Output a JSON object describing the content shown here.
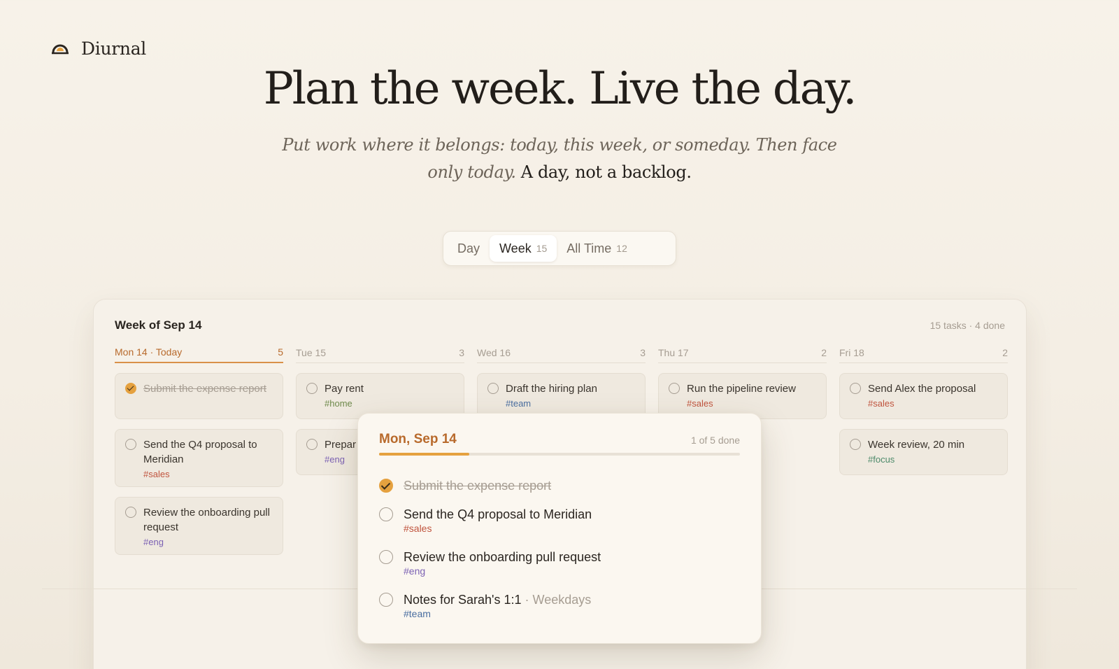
{
  "brand": {
    "name": "Diurnal"
  },
  "hero": {
    "title": "Plan the week. Live the day.",
    "subtitle_italic": "Put work where it belongs: today, this week, or someday. Then face only today.",
    "subtitle_plain": "A day, not a backlog."
  },
  "view_switcher": {
    "items": [
      {
        "label": "Day",
        "count": ""
      },
      {
        "label": "Week",
        "count": "15"
      },
      {
        "label": "All Time",
        "count": "12"
      }
    ],
    "selected": "Week"
  },
  "board": {
    "title": "Week of Sep 14",
    "stats": "15 tasks · 4 done",
    "columns": [
      {
        "label": "Mon 14 · Today",
        "count": "5",
        "tasks": [
          {
            "text": "Submit the expense report",
            "tag": "",
            "done": true
          },
          {
            "text": "Send the Q4 proposal to Meridian",
            "tag": "#sales",
            "done": false
          },
          {
            "text": "Review the onboarding pull request",
            "tag": "#eng",
            "done": false
          }
        ]
      },
      {
        "label": "Tue 15",
        "count": "3",
        "tasks": [
          {
            "text": "Pay rent",
            "tag": "#home",
            "done": false
          },
          {
            "text": "Prepar",
            "tag": "#eng",
            "done": false
          }
        ]
      },
      {
        "label": "Wed 16",
        "count": "3",
        "tasks": [
          {
            "text": "Draft the hiring plan",
            "tag": "#team",
            "done": false
          }
        ]
      },
      {
        "label": "Thu 17",
        "count": "2",
        "tasks": [
          {
            "text": "Run the pipeline review",
            "tag": "#sales",
            "done": false
          }
        ]
      },
      {
        "label": "Fri 18",
        "count": "2",
        "tasks": [
          {
            "text": "Send Alex the proposal",
            "tag": "#sales",
            "done": false
          },
          {
            "text": "Week review, 20 min",
            "tag": "#focus",
            "done": false
          }
        ]
      }
    ]
  },
  "day_popup": {
    "title": "Mon, Sep 14",
    "stat": "1 of 5 done",
    "progress": 0.25,
    "tasks": [
      {
        "text": "Submit the expense report",
        "tag": "",
        "repeat": "",
        "done": true
      },
      {
        "text": "Send the Q4 proposal to Meridian",
        "tag": "#sales",
        "repeat": "",
        "done": false
      },
      {
        "text": "Review the onboarding pull request",
        "tag": "#eng",
        "repeat": "",
        "done": false
      },
      {
        "text": "Notes for Sarah's 1:1",
        "tag": "#team",
        "repeat": "· Weekdays",
        "done": false
      }
    ]
  },
  "colors": {
    "accent": "#e5a13f",
    "today_text": "#b86a2c",
    "tag_sales": "#c0543e",
    "tag_home": "#6e8a4b",
    "tag_team": "#4a6ea0",
    "tag_eng": "#7c62b4",
    "tag_focus": "#4d8a6a"
  }
}
